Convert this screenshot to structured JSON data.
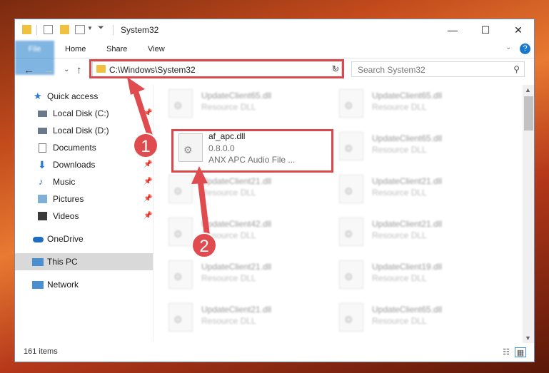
{
  "window": {
    "title": "System32"
  },
  "ribbon": {
    "tabs": [
      "File",
      "Home",
      "Share",
      "View"
    ],
    "help": "?"
  },
  "nav": {
    "back": "←",
    "forward": "→",
    "recent": "⌄",
    "up": "↑"
  },
  "address": {
    "path": "C:\\Windows\\System32"
  },
  "search": {
    "placeholder": "Search System32"
  },
  "sidebar": {
    "items": [
      {
        "label": "Quick access",
        "icon": "star-icon"
      },
      {
        "label": "Local Disk (C:)",
        "icon": "drive-icon"
      },
      {
        "label": "Local Disk (D:)",
        "icon": "drive-icon"
      },
      {
        "label": "Documents",
        "icon": "documents-icon"
      },
      {
        "label": "Downloads",
        "icon": "download-icon"
      },
      {
        "label": "Music",
        "icon": "music-icon"
      },
      {
        "label": "Pictures",
        "icon": "pictures-icon"
      },
      {
        "label": "Videos",
        "icon": "videos-icon"
      },
      {
        "label": "OneDrive",
        "icon": "cloud-icon"
      },
      {
        "label": "This PC",
        "icon": "computer-icon"
      },
      {
        "label": "Network",
        "icon": "network-icon"
      }
    ]
  },
  "files": {
    "left": [
      {
        "name": "UpdateClient65.dll",
        "desc": "Resource DLL"
      },
      {
        "name": "af_apc.dll",
        "version": "0.8.0.0",
        "desc": "ANX APC Audio File ..."
      },
      {
        "name": "UpdateClient21.dll",
        "desc": "Resource DLL"
      },
      {
        "name": "UpdateClient42.dll",
        "desc": "Resource DLL"
      },
      {
        "name": "UpdateClient21.dll",
        "desc": "Resource DLL"
      },
      {
        "name": "UpdateClient21.dll",
        "desc": "Resource DLL"
      }
    ],
    "right": [
      {
        "name": "UpdateClient65.dll",
        "desc": "Resource DLL"
      },
      {
        "name": "UpdateClient65.dll",
        "desc": "Resource DLL"
      },
      {
        "name": "UpdateClient21.dll",
        "desc": "Resource DLL"
      },
      {
        "name": "UpdateClient21.dll",
        "desc": "Resource DLL"
      },
      {
        "name": "UpdateClient19.dll",
        "desc": "Resource DLL"
      },
      {
        "name": "UpdateClient65.dll",
        "desc": "Resource DLL"
      }
    ]
  },
  "status": {
    "count": "161 items"
  },
  "annotations": {
    "badge1": "1",
    "badge2": "2",
    "accent": "#e04b50"
  }
}
